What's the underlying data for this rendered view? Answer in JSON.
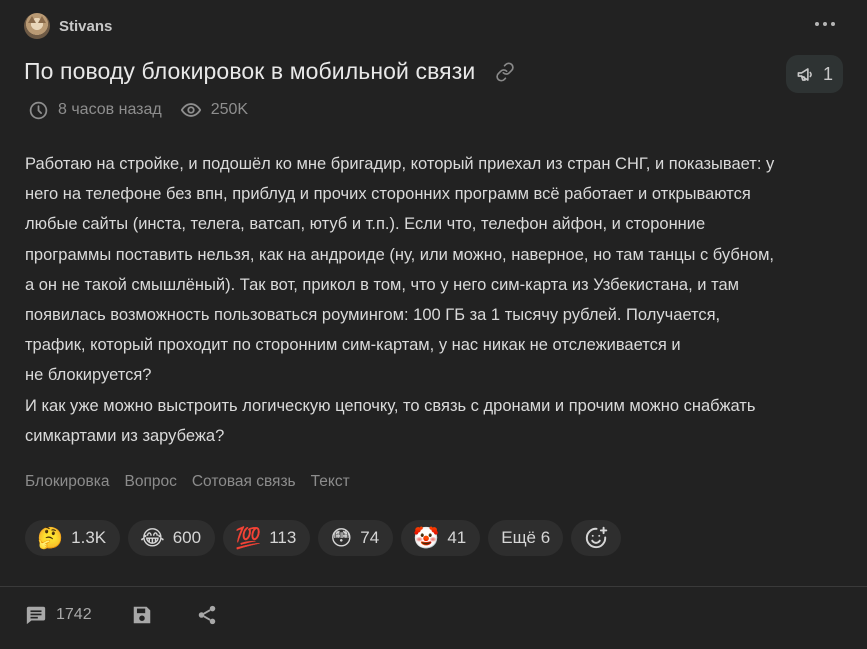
{
  "author": {
    "name": "Stivans",
    "avatar": "cat-avatar"
  },
  "post": {
    "title": "По поводу блокировок в мобильной связи",
    "time": "8 часов назад",
    "views": "250K",
    "repost_count": "1",
    "body": [
      "Работаю на стройке, и подошёл ко мне бригадир, который приехал из стран СНГ, и показывает: у",
      "него на телефоне без впн, приблуд и прочих сторонних программ всё работает и открываются",
      "любые сайты (инста, телега, ватсап, ютуб и т.п.). Если что, телефон айфон, и сторонние",
      "программы поставить нельзя, как на андроиде (ну, или можно, наверное, но там танцы с бубном,",
      "а он не такой смышлёный). Так вот, прикол в том, что у него сим-карта из Узбекистана, и там",
      "появилась возможность пользоваться роумингом: 100 ГБ за 1 тысячу рублей. Получается,",
      "трафик, который проходит по сторонним сим-картам, у нас никак не отслеживается и",
      "не блокируется?",
      "И как уже можно выстроить логическую цепочку, то связь с дронами и прочим можно снабжать",
      "симкартами из зарубежа?"
    ],
    "tags": [
      "Блокировка",
      "Вопрос",
      "Сотовая связь",
      "Текст"
    ]
  },
  "reactions": [
    {
      "emoji": "🤔",
      "icon": "thinking-face-icon",
      "count": "1.3K"
    },
    {
      "emoji": "😂",
      "icon": "laughing-face-icon",
      "count": "600"
    },
    {
      "emoji": "💯",
      "icon": "hundred-points-icon",
      "count": "113"
    },
    {
      "emoji": "😳",
      "icon": "shocked-face-icon",
      "count": "74"
    },
    {
      "emoji": "🤡",
      "icon": "clown-face-icon",
      "count": "41"
    }
  ],
  "reactions_more": "Ещё 6",
  "footer": {
    "comments": "1742"
  },
  "colors": {
    "background": "#222222",
    "chip": "#2e2e2e",
    "muted": "#8e8e8e",
    "text": "#dadada"
  }
}
